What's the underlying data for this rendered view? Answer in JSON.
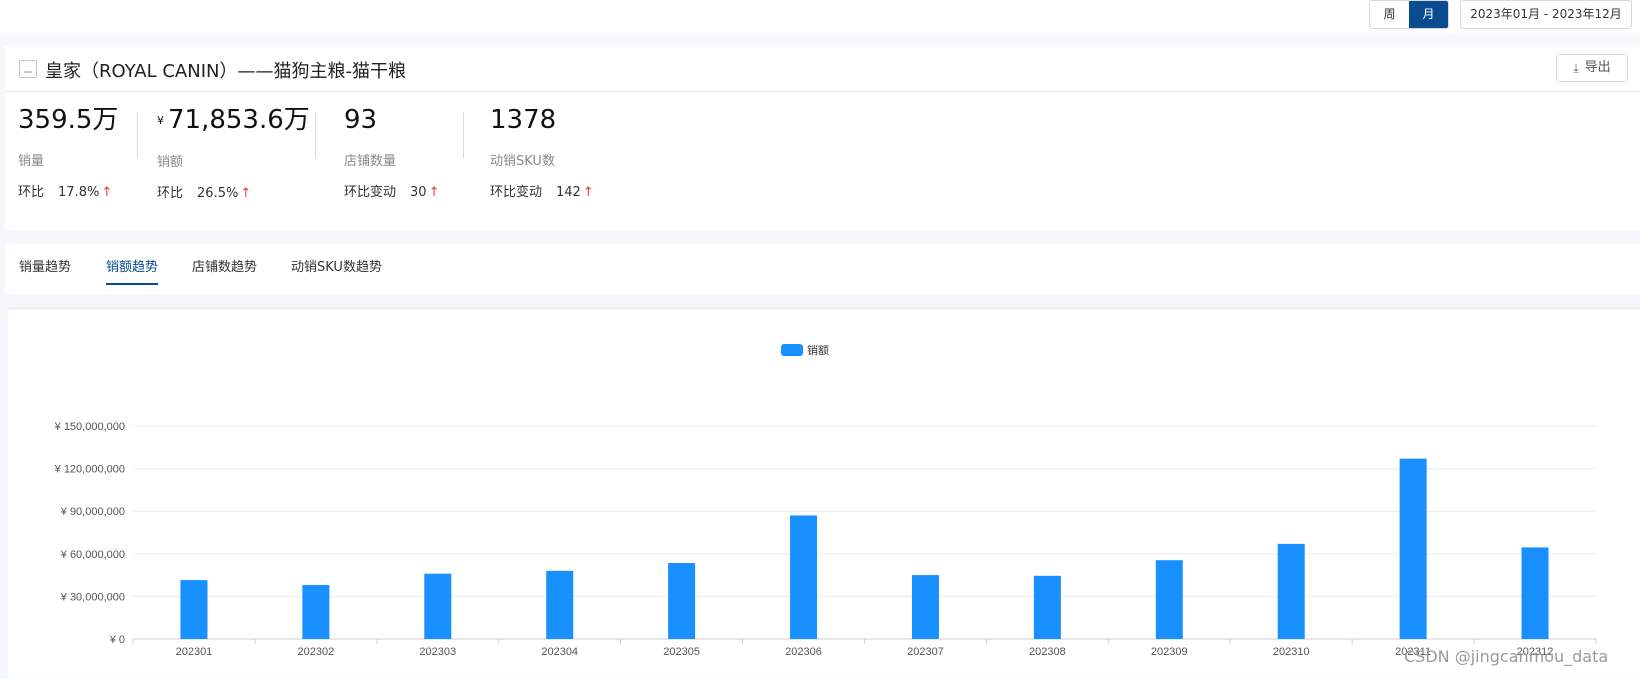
{
  "topbar": {
    "period_options": [
      "周",
      "月"
    ],
    "selected_period": "月",
    "date_range": "2023年01月 - 2023年12月"
  },
  "header": {
    "title": "皇家（ROYAL CANIN）——猫狗主粮-猫干粮",
    "export_label": "导出"
  },
  "metrics": [
    {
      "value": "359.5万",
      "currency": "",
      "label": "销量",
      "change_label": "环比",
      "change_value": "17.8%",
      "direction": "up"
    },
    {
      "value": "71,853.6万",
      "currency": "¥",
      "label": "销额",
      "change_label": "环比",
      "change_value": "26.5%",
      "direction": "up"
    },
    {
      "value": "93",
      "currency": "",
      "label": "店铺数量",
      "change_label": "环比变动",
      "change_value": "30",
      "direction": "up"
    },
    {
      "value": "1378",
      "currency": "",
      "label": "动销SKU数",
      "change_label": "环比变动",
      "change_value": "142",
      "direction": "up"
    }
  ],
  "tabs": [
    {
      "label": "销量趋势",
      "active": false
    },
    {
      "label": "销额趋势",
      "active": true
    },
    {
      "label": "店铺数趋势",
      "active": false
    },
    {
      "label": "动销SKU数趋势",
      "active": false
    }
  ],
  "chart_data": {
    "type": "bar",
    "legend": [
      "销额"
    ],
    "legend_position": "top-center",
    "color": "#1890ff",
    "categories": [
      "202301",
      "202302",
      "202303",
      "202304",
      "202305",
      "202306",
      "202307",
      "202308",
      "202309",
      "202310",
      "202311",
      "202312"
    ],
    "series": [
      {
        "name": "销额",
        "values": [
          41500000,
          38000000,
          46000000,
          48000000,
          53500000,
          87000000,
          45000000,
          44500000,
          55500000,
          67000000,
          127000000,
          64500000
        ]
      }
    ],
    "yticks": [
      "¥ 0",
      "¥ 30,000,000",
      "¥ 60,000,000",
      "¥ 90,000,000",
      "¥ 120,000,000",
      "¥ 150,000,000"
    ],
    "ylim": [
      0,
      150000000
    ],
    "grid": true
  },
  "watermark": "CSDN @jingcanmou_data"
}
